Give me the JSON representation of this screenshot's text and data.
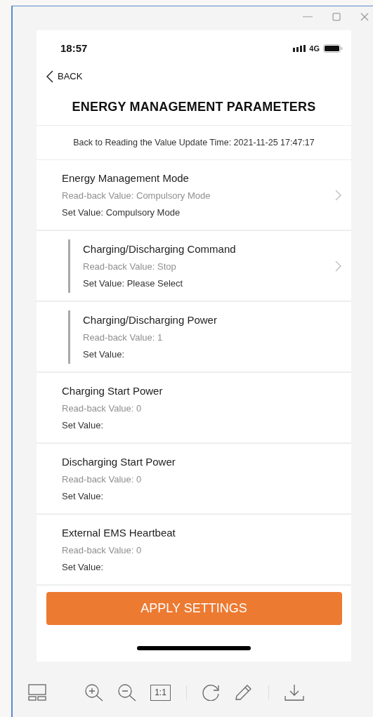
{
  "status_bar": {
    "time": "18:57",
    "network": "4G"
  },
  "nav": {
    "back": "BACK",
    "title": "ENERGY MANAGEMENT PARAMETERS"
  },
  "update_time": "Back to Reading the Value Update Time: 2021-11-25 17:47:17",
  "parameters": [
    {
      "title": "Energy Management Mode",
      "readback": "Read-back Value: Compulsory Mode",
      "set_value": "Set Value: Compulsory Mode",
      "chevron": true,
      "children": [
        {
          "title": "Charging/Discharging Command",
          "readback": "Read-back Value: Stop",
          "set_value": "Set Value: Please Select",
          "chevron": true
        },
        {
          "title": "Charging/Discharging Power",
          "readback": "Read-back Value: 1",
          "set_value": "Set Value:",
          "chevron": false
        }
      ]
    },
    {
      "title": "Charging Start Power",
      "readback": "Read-back Value: 0",
      "set_value": "Set Value:",
      "chevron": false
    },
    {
      "title": "Discharging Start Power",
      "readback": "Read-back Value: 0",
      "set_value": "Set Value:",
      "chevron": false
    },
    {
      "title": "External EMS Heartbeat",
      "readback": "Read-back Value: 0",
      "set_value": "Set Value:",
      "chevron": false
    }
  ],
  "apply_button": "APPLY SETTINGS",
  "viewer_toolbar": {
    "actual_size": "1:1"
  }
}
